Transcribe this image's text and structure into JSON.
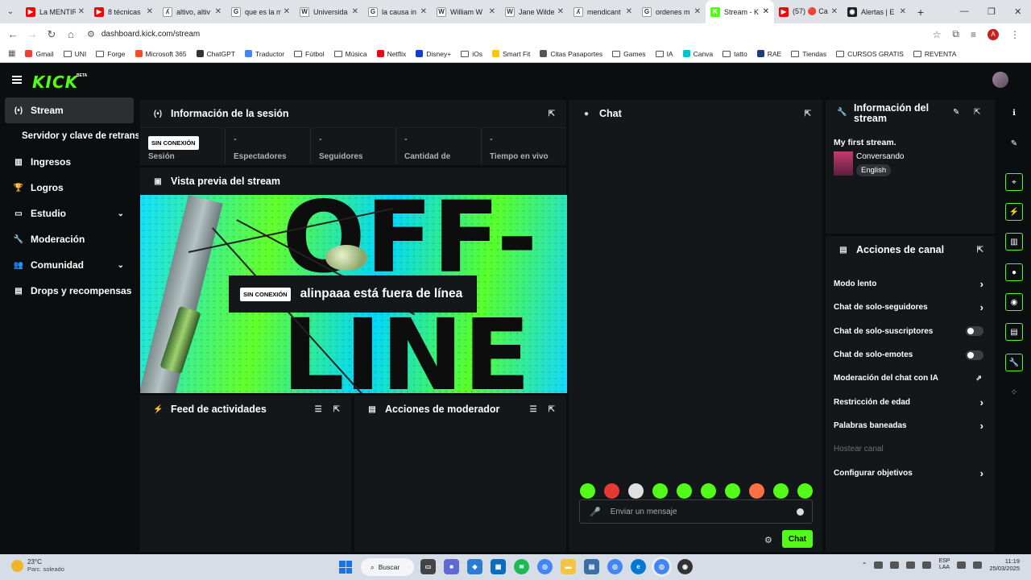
{
  "browser": {
    "tabs": [
      {
        "title": "La MENTIR",
        "color": "#ff0000",
        "glyph": "▶"
      },
      {
        "title": "8 técnicas",
        "color": "#ff0000",
        "glyph": "▶"
      },
      {
        "title": "altivo, altiv",
        "color": "#ffffff",
        "glyph": "ʎ"
      },
      {
        "title": "que es la m",
        "color": "#ffffff",
        "glyph": "G"
      },
      {
        "title": "Universida",
        "color": "#ffffff",
        "glyph": "W"
      },
      {
        "title": "la causa in",
        "color": "#ffffff",
        "glyph": "G"
      },
      {
        "title": "William W",
        "color": "#ffffff",
        "glyph": "W"
      },
      {
        "title": "Jane Wilde",
        "color": "#ffffff",
        "glyph": "W"
      },
      {
        "title": "mendicant",
        "color": "#ffffff",
        "glyph": "ʎ"
      },
      {
        "title": "ordenes m",
        "color": "#ffffff",
        "glyph": "G"
      },
      {
        "title": "Stream - K",
        "color": "#53fc18",
        "glyph": "K",
        "active": true
      },
      {
        "title": "(57) 🔴 Ca",
        "color": "#ff0000",
        "glyph": "▶"
      },
      {
        "title": "Alertas | E",
        "color": "#222222",
        "glyph": "◉"
      }
    ],
    "url": "dashboard.kick.com/stream",
    "bookmarks": [
      {
        "label": "Gmail",
        "kind": "icon",
        "color": "#ea4335"
      },
      {
        "label": "UNI",
        "kind": "folder"
      },
      {
        "label": "Forge",
        "kind": "folder"
      },
      {
        "label": "Microsoft 365",
        "kind": "icon",
        "color": "#f25022"
      },
      {
        "label": "ChatGPT",
        "kind": "icon",
        "color": "#333333"
      },
      {
        "label": "Traductor",
        "kind": "icon",
        "color": "#4285f4"
      },
      {
        "label": "Fútbol",
        "kind": "folder"
      },
      {
        "label": "Música",
        "kind": "folder"
      },
      {
        "label": "Netflix",
        "kind": "icon",
        "color": "#e50914"
      },
      {
        "label": "Disney+",
        "kind": "icon",
        "color": "#113ccf"
      },
      {
        "label": "iOs",
        "kind": "folder"
      },
      {
        "label": "Smart Fit",
        "kind": "icon",
        "color": "#ffc20e"
      },
      {
        "label": "Citas Pasaportes",
        "kind": "icon",
        "color": "#555555"
      },
      {
        "label": "Games",
        "kind": "folder"
      },
      {
        "label": "IA",
        "kind": "folder"
      },
      {
        "label": "Canva",
        "kind": "icon",
        "color": "#00c4cc"
      },
      {
        "label": "tatto",
        "kind": "folder"
      },
      {
        "label": "RAE",
        "kind": "icon",
        "color": "#1a3d7c"
      },
      {
        "label": "Tiendas",
        "kind": "folder"
      },
      {
        "label": "CURSOS GRATIS",
        "kind": "folder"
      },
      {
        "label": "REVENTA",
        "kind": "folder"
      }
    ]
  },
  "app": {
    "logo": "KICK",
    "logo_badge": "BETA",
    "accent": "#53fc18",
    "sidebar": [
      {
        "label": "Stream",
        "icon": "broadcast-icon",
        "active": true
      },
      {
        "label": "Servidor y clave de retransmisión",
        "icon": "",
        "sub": true
      },
      {
        "label": "Ingresos",
        "icon": "chart-icon"
      },
      {
        "label": "Logros",
        "icon": "trophy-icon"
      },
      {
        "label": "Estudio",
        "icon": "studio-icon",
        "expandable": true
      },
      {
        "label": "Moderación",
        "icon": "wrench-icon"
      },
      {
        "label": "Comunidad",
        "icon": "people-icon",
        "expandable": true
      },
      {
        "label": "Drops y recompensas",
        "icon": "gift-icon"
      }
    ],
    "session": {
      "title": "Información de la sesión",
      "badge": "SIN CONEXIÓN",
      "stats": [
        {
          "value": "",
          "label": "Sesión"
        },
        {
          "value": "-",
          "label": "Espectadores"
        },
        {
          "value": "-",
          "label": "Seguidores"
        },
        {
          "value": "-",
          "label": "Cantidad de"
        },
        {
          "value": "-",
          "label": "Tiempo en vivo"
        }
      ]
    },
    "preview": {
      "title": "Vista previa del stream",
      "offline_badge": "SIN CONEXIÓN",
      "offline_message": "alinpaaa está fuera de línea",
      "art_text_1": "OFF-",
      "art_text_2": "LINE"
    },
    "activity_feed": {
      "title": "Feed de actividades"
    },
    "mod_actions": {
      "title": "Acciones de moderador"
    },
    "chat": {
      "title": "Chat",
      "placeholder": "Enviar un mensaje",
      "send_label": "Chat",
      "emote_colors": [
        "#53fc18",
        "#e53935",
        "#e0e0e0",
        "#53fc18",
        "#53fc18",
        "#53fc18",
        "#53fc18",
        "#ff7043",
        "#53fc18",
        "#53fc18"
      ]
    },
    "stream_info": {
      "title_line1": "Información del",
      "title_line2": "stream",
      "stream_title": "My first stream.",
      "category": "Conversando",
      "language": "English"
    },
    "channel_actions": {
      "title": "Acciones de canal",
      "items": [
        {
          "label": "Modo lento",
          "control": "chevron"
        },
        {
          "label": "Chat de solo-seguidores",
          "control": "chevron"
        },
        {
          "label": "Chat de solo-suscriptores",
          "control": "toggle",
          "on": false
        },
        {
          "label": "Chat de solo-emotes",
          "control": "toggle",
          "on": false
        },
        {
          "label": "Moderación del chat con IA",
          "control": "external"
        },
        {
          "label": "Restricción de edad",
          "control": "chevron"
        },
        {
          "label": "Palabras baneadas",
          "control": "chevron"
        },
        {
          "label": "Hostear canal",
          "control": "none",
          "disabled": true
        },
        {
          "label": "Configurar objetivos",
          "control": "chevron"
        }
      ]
    }
  },
  "taskbar": {
    "weather_temp": "23°C",
    "weather_desc": "Parc. soleado",
    "search_label": "Buscar",
    "lang_1": "ESP",
    "lang_2": "LAA",
    "time": "11:19",
    "date": "25/03/2025"
  }
}
